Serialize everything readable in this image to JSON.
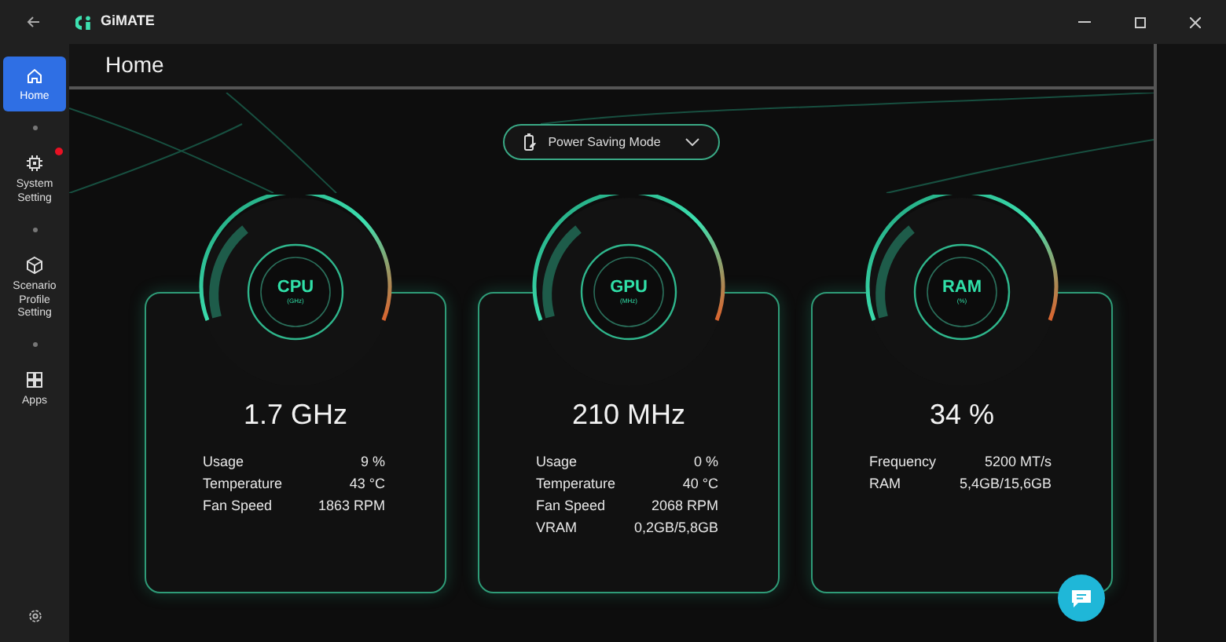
{
  "window": {
    "app_name": "GiMATE"
  },
  "sidebar": {
    "items": [
      {
        "label": "Home",
        "selected": true,
        "notification": false
      },
      {
        "label": "System Setting",
        "selected": false,
        "notification": true
      },
      {
        "label": "Scenario Profile Setting",
        "selected": false,
        "notification": false
      },
      {
        "label": "Apps",
        "selected": false,
        "notification": false
      }
    ]
  },
  "page": {
    "title": "Home"
  },
  "mode_dropdown": {
    "value": "Power Saving Mode"
  },
  "monitors": [
    {
      "name": "CPU",
      "unit": "(GHz)",
      "reading": "1.7 GHz",
      "stats": [
        {
          "label": "Usage",
          "value": "9 %"
        },
        {
          "label": "Temperature",
          "value": "43 °C"
        },
        {
          "label": "Fan Speed",
          "value": "1863 RPM"
        }
      ]
    },
    {
      "name": "GPU",
      "unit": "(MHz)",
      "reading": "210 MHz",
      "stats": [
        {
          "label": "Usage",
          "value": "0 %"
        },
        {
          "label": "Temperature",
          "value": "40 °C"
        },
        {
          "label": "Fan Speed",
          "value": "2068 RPM"
        },
        {
          "label": "VRAM",
          "value": "0,2GB/5,8GB"
        }
      ]
    },
    {
      "name": "RAM",
      "unit": "(%)",
      "reading": "34 %",
      "stats": [
        {
          "label": "Frequency",
          "value": "5200 MT/s"
        },
        {
          "label": "RAM",
          "value": "5,4GB/15,6GB"
        }
      ]
    }
  ]
}
